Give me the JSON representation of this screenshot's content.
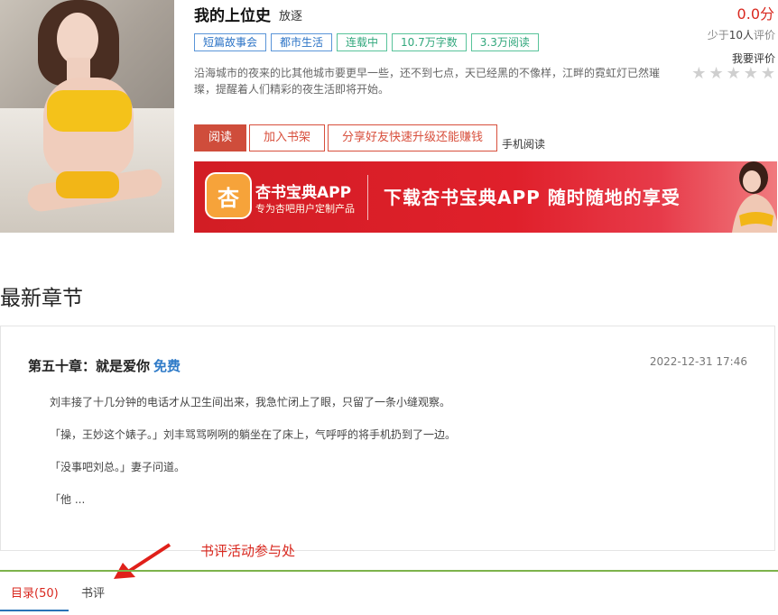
{
  "book": {
    "title": "我的上位史",
    "author": "放逐",
    "tags": [
      {
        "label": "短篇故事会",
        "color": "blue"
      },
      {
        "label": "都市生活",
        "color": "blue"
      },
      {
        "label": "连载中",
        "color": "green"
      },
      {
        "label": "10.7万字数",
        "color": "green"
      },
      {
        "label": "3.3万阅读",
        "color": "green"
      }
    ],
    "description": "沿海城市的夜来的比其他城市要更早一些，还不到七点，天已经黑的不像样，江畔的霓虹灯已然璀璨，提醒着人们精彩的夜生活即将开始。"
  },
  "rating": {
    "score": "0.0分",
    "raters_prefix": "少于",
    "raters_count": "10人",
    "raters_suffix": "评价",
    "rate_link": "我要评价",
    "stars": 0
  },
  "actions": {
    "read": "阅读",
    "add_shelf": "加入书架",
    "share": "分享好友快速升级还能赚钱",
    "mobile": "手机阅读"
  },
  "banner": {
    "app_name": "杏书宝典APP",
    "app_sub": "专为杏吧用户定制产品",
    "slogan": "下载杏书宝典APP  随时随地的享受",
    "logo_char": "杏"
  },
  "latest": {
    "heading": "最新章节",
    "chapter_title": "第五十章：就是爱你",
    "free_label": "免费",
    "date": "2022-12-31 17:46",
    "paragraphs": [
      "刘丰接了十几分钟的电话才从卫生间出来，我急忙闭上了眼，只留了一条小缝观察。",
      "「操，王妙这个婊子。」刘丰骂骂咧咧的躺坐在了床上，气呼呼的将手机扔到了一边。",
      "「没事吧刘总。」妻子问道。",
      "「他 ..."
    ]
  },
  "annotation": "书评活动参与处",
  "tabs": [
    {
      "label": "目录(50)",
      "active": true
    },
    {
      "label": "书评",
      "active": false
    }
  ],
  "colors": {
    "accent_red": "#d9281f",
    "button_red": "#cf4d3b",
    "tag_blue": "#2b73c6",
    "tag_green": "#31a77c",
    "tab_border_green": "#7db34b"
  }
}
